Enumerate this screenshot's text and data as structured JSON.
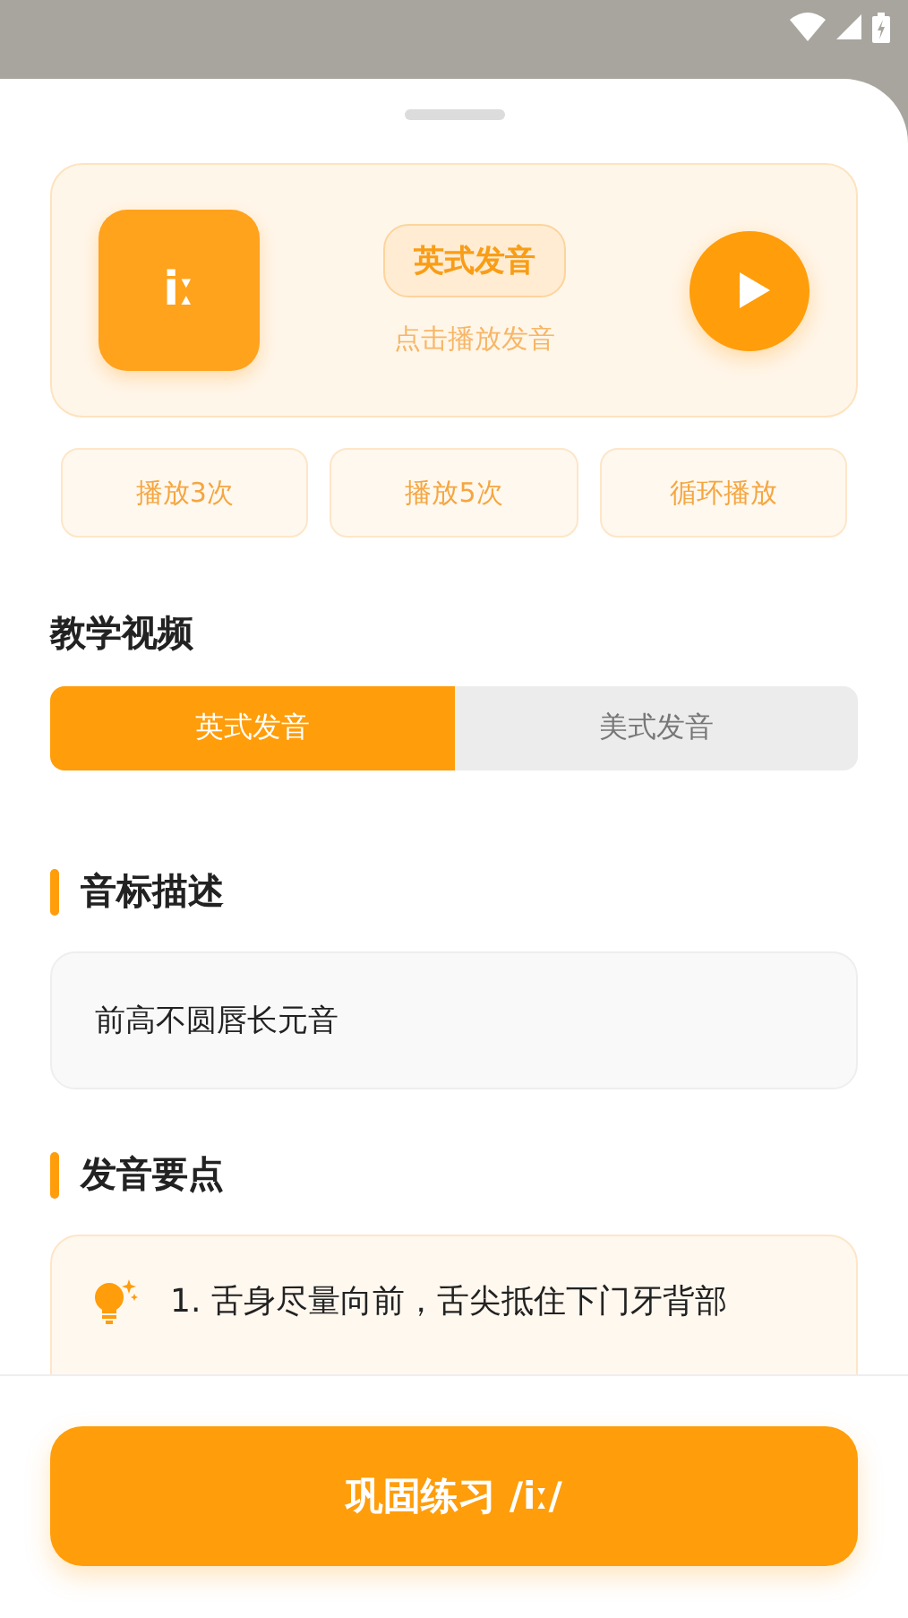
{
  "sound_card": {
    "symbol": "iː",
    "accent_badge": "英式发音",
    "hint": "点击播放发音"
  },
  "repeat_buttons": [
    "播放3次",
    "播放5次",
    "循环播放"
  ],
  "video_section": {
    "title": "教学视频",
    "tabs": [
      {
        "label": "英式发音",
        "selected": true
      },
      {
        "label": "美式发音",
        "selected": false
      }
    ]
  },
  "description": {
    "title": "音标描述",
    "text": "前高不圆唇长元音"
  },
  "tips": {
    "title": "发音要点",
    "items": [
      "1. 舌身尽量向前，舌尖抵住下门牙背部"
    ]
  },
  "practice_button": "巩固练习 /iː/"
}
